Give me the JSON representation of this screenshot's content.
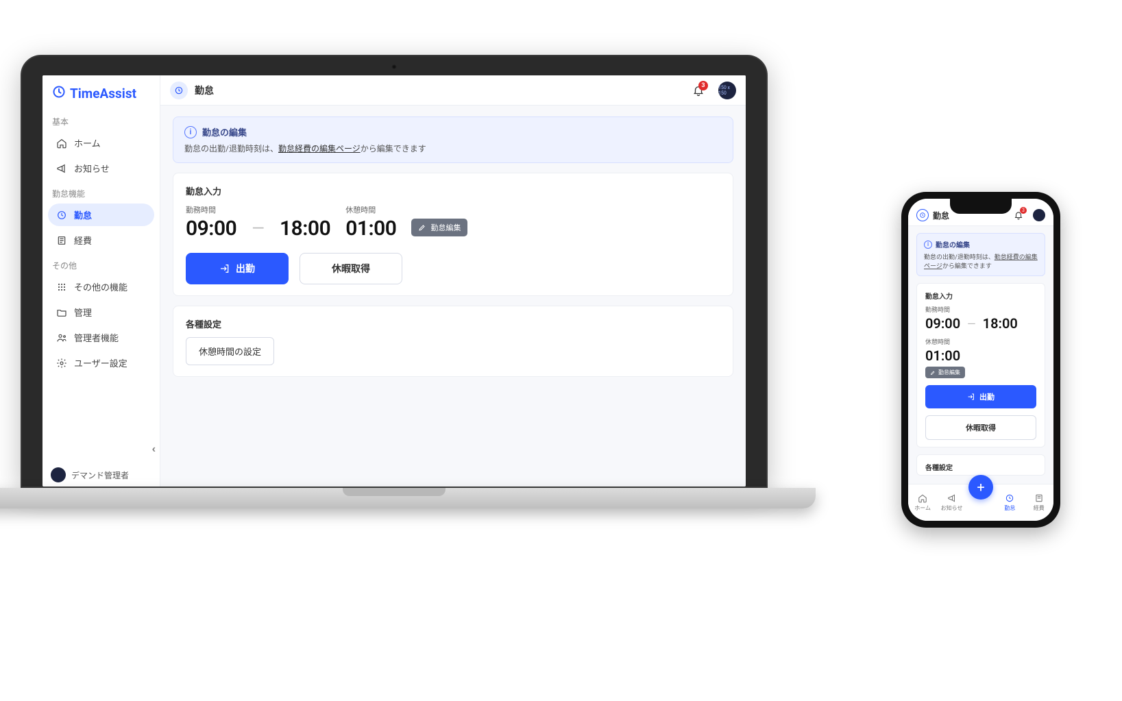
{
  "brand": "TimeAssist",
  "header": {
    "title": "勤怠",
    "notification_count": "3",
    "avatar_text": "150 x 150"
  },
  "sidebar": {
    "sections": {
      "basic": "基本",
      "kintai": "勤怠機能",
      "other": "その他"
    },
    "items": {
      "home": "ホーム",
      "notice": "お知らせ",
      "attendance": "勤怠",
      "expense": "経費",
      "other_fn": "その他の機能",
      "admin": "管理",
      "manager": "管理者機能",
      "user_settings": "ユーザー設定"
    },
    "user_name": "デマンド管理者"
  },
  "banner": {
    "title": "勤怠の編集",
    "body_prefix": "勤怠の出勤/退勤時刻は、",
    "body_link": "勤怠経費の編集ページ",
    "body_suffix": "から編集できます"
  },
  "card_input": {
    "title": "勤怠入力",
    "work_label": "勤務時間",
    "work_start": "09:00",
    "work_end": "18:00",
    "break_label": "休憩時間",
    "break_time": "01:00",
    "edit_btn": "勤怠編集",
    "clockin_btn": "出勤",
    "leave_btn": "休暇取得"
  },
  "card_settings": {
    "title": "各種設定",
    "break_setting_btn": "休憩時間の設定"
  },
  "phone": {
    "tabs": {
      "home": "ホーム",
      "notice": "お知らせ",
      "attendance": "勤怠",
      "expense": "経費"
    },
    "notification_count": "3"
  }
}
